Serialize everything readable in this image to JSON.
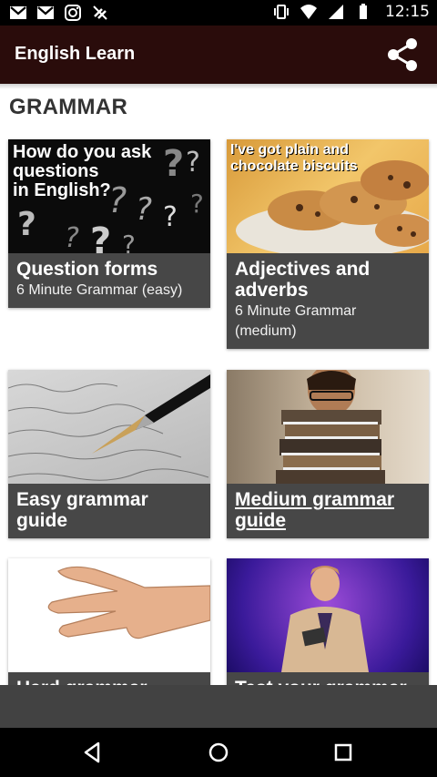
{
  "status_bar": {
    "time": "12:15",
    "left_icons": [
      "gmail-icon",
      "gmail-icon",
      "instagram-icon",
      "no-sync-icon"
    ],
    "right_icons": [
      "vibrate-icon",
      "wifi-icon",
      "signal-icon",
      "battery-icon"
    ]
  },
  "app_bar": {
    "title": "English Learn",
    "background": "#2a0c0b"
  },
  "section": {
    "title": "GRAMMAR"
  },
  "cards": [
    {
      "title": "Question forms",
      "subtitle": "6 Minute Grammar (easy)",
      "image_text": [
        "How do you ask",
        "questions",
        "in English?"
      ]
    },
    {
      "title": "Adjectives and adverbs",
      "subtitle": "6 Minute Grammar (medium)",
      "image_text": [
        "I've got plain and",
        "chocolate biscuits"
      ]
    },
    {
      "title": "Easy grammar guide"
    },
    {
      "title": "Medium grammar guide"
    },
    {
      "title": "Hard grammar guide"
    },
    {
      "title": "Test your grammar"
    }
  ],
  "nav": {
    "icons": [
      "back-icon",
      "home-icon",
      "recents-icon"
    ]
  }
}
